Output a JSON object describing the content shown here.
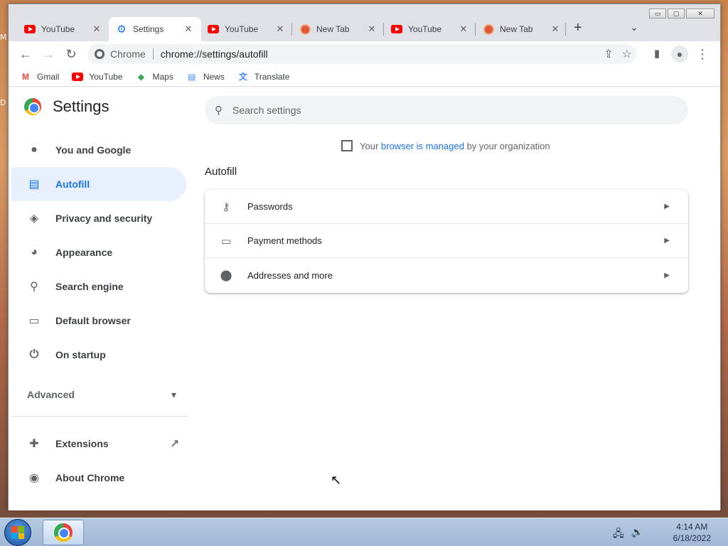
{
  "desktop": {
    "label_top": "M",
    "label_mid": "D"
  },
  "window": {
    "controls": {
      "minimize": "▭",
      "maximize": "▢",
      "close": "✕"
    }
  },
  "tabs": [
    {
      "title": "YouTube",
      "icon": "youtube-icon",
      "active": false
    },
    {
      "title": "Settings",
      "icon": "gear-icon",
      "active": true
    },
    {
      "title": "YouTube",
      "icon": "youtube-icon",
      "active": false
    },
    {
      "title": "New Tab",
      "icon": "duckduckgo-icon",
      "active": false
    },
    {
      "title": "YouTube",
      "icon": "youtube-icon",
      "active": false
    },
    {
      "title": "New Tab",
      "icon": "duckduckgo-icon",
      "active": false
    }
  ],
  "tab_close": "✕",
  "new_tab": "+",
  "tab_search": "⌄",
  "toolbar": {
    "back": "←",
    "forward": "→",
    "reload": "↻",
    "omnibox_label": "Chrome",
    "url": "chrome://settings/autofill",
    "share": "⇪",
    "star": "☆",
    "side_panel": "▮",
    "profile": "●",
    "menu": "⋮"
  },
  "bookmarks": [
    {
      "label": "Gmail",
      "icon": "gmail-icon"
    },
    {
      "label": "YouTube",
      "icon": "youtube-icon"
    },
    {
      "label": "Maps",
      "icon": "maps-icon"
    },
    {
      "label": "News",
      "icon": "news-icon"
    },
    {
      "label": "Translate",
      "icon": "translate-icon"
    }
  ],
  "settings": {
    "title": "Settings",
    "nav": [
      {
        "label": "You and Google",
        "icon": "person-icon",
        "glyph": "👤",
        "active": false
      },
      {
        "label": "Autofill",
        "icon": "clipboard-icon",
        "glyph": "📋",
        "active": true
      },
      {
        "label": "Privacy and security",
        "icon": "shield-icon",
        "glyph": "🛡",
        "active": false
      },
      {
        "label": "Appearance",
        "icon": "palette-icon",
        "glyph": "🎨",
        "active": false
      },
      {
        "label": "Search engine",
        "icon": "search-icon",
        "glyph": "🔍",
        "active": false
      },
      {
        "label": "Default browser",
        "icon": "browser-icon",
        "glyph": "▭",
        "active": false
      },
      {
        "label": "On startup",
        "icon": "power-icon",
        "glyph": "⏻",
        "active": false
      }
    ],
    "advanced": "Advanced",
    "advanced_arrow": "▾",
    "nav2": [
      {
        "label": "Extensions",
        "icon": "puzzle-icon",
        "glyph": "🧩"
      },
      {
        "label": "About Chrome",
        "icon": "chrome-icon",
        "glyph": "◉"
      }
    ],
    "external_link": "↗",
    "search_placeholder": "Search settings",
    "managed": {
      "prefix": "Your ",
      "link": "browser is managed",
      "suffix": " by your organization"
    },
    "section_title": "Autofill",
    "rows": [
      {
        "label": "Passwords",
        "icon": "key-icon",
        "glyph": "⚷"
      },
      {
        "label": "Payment methods",
        "icon": "credit-card-icon",
        "glyph": "▭"
      },
      {
        "label": "Addresses and more",
        "icon": "location-pin-icon",
        "glyph": "⬤"
      }
    ],
    "row_arrow": "▶"
  },
  "taskbar": {
    "time": "4:14 AM",
    "date": "6/18/2022",
    "network": "🖧",
    "volume": "🔊"
  },
  "colors": {
    "accent": "#1a73e8",
    "active_nav_bg": "#e8f0fe"
  }
}
